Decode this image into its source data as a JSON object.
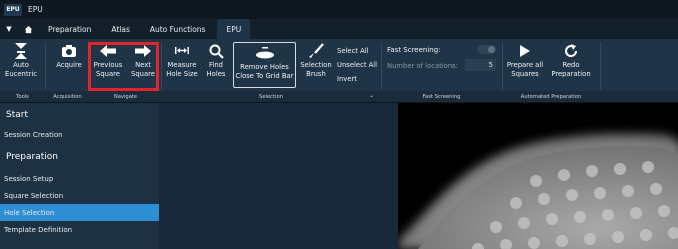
{
  "window": {
    "logo_text": "EPU",
    "title": "EPU"
  },
  "menubar": {
    "tabs": [
      {
        "label": "Preparation"
      },
      {
        "label": "Atlas"
      },
      {
        "label": "Auto Functions"
      },
      {
        "label": "EPU"
      }
    ],
    "active_tab": "EPU"
  },
  "ribbon": {
    "buttons": {
      "auto_eucentric": "Auto\nEucentric",
      "acquire": "Acquire",
      "previous_square": "Previous\nSquare",
      "next_square": "Next\nSquare",
      "measure_hole_size": "Measure\nHole Size",
      "find_holes": "Find\nHoles",
      "remove_holes": "Remove Holes\nClose To Grid Bar",
      "selection_brush": "Selection\nBrush",
      "prepare_all_squares": "Prepare all\nSquares",
      "redo_preparation": "Redo\nPreparation"
    },
    "selection_list": {
      "select_all": "Select All",
      "unselect_all": "Unselect All",
      "invert": "Invert"
    },
    "fast_screening": {
      "title": "Fast Screening:",
      "locations_label": "Number of locations:",
      "locations_value": "5",
      "enabled": false
    },
    "groups": {
      "tools": "Tools",
      "acquisition": "Acquisition",
      "navigate": "Navigate",
      "selection": "Selection",
      "fast_screening": "Fast Screening",
      "automated_preparation": "Automated Preparation"
    }
  },
  "sidebar": {
    "start_header": "Start",
    "start_items": [
      {
        "label": "Session Creation"
      }
    ],
    "prep_header": "Preparation",
    "prep_items": [
      {
        "label": "Session Setup"
      },
      {
        "label": "Square Selection"
      },
      {
        "label": "Hole Selection"
      },
      {
        "label": "Template Definition"
      }
    ],
    "active_item": "Hole Selection"
  },
  "colors": {
    "highlight_box": "#e5232b",
    "active_item": "#2d8ed3",
    "ribbon_bg": "#1f3446"
  }
}
